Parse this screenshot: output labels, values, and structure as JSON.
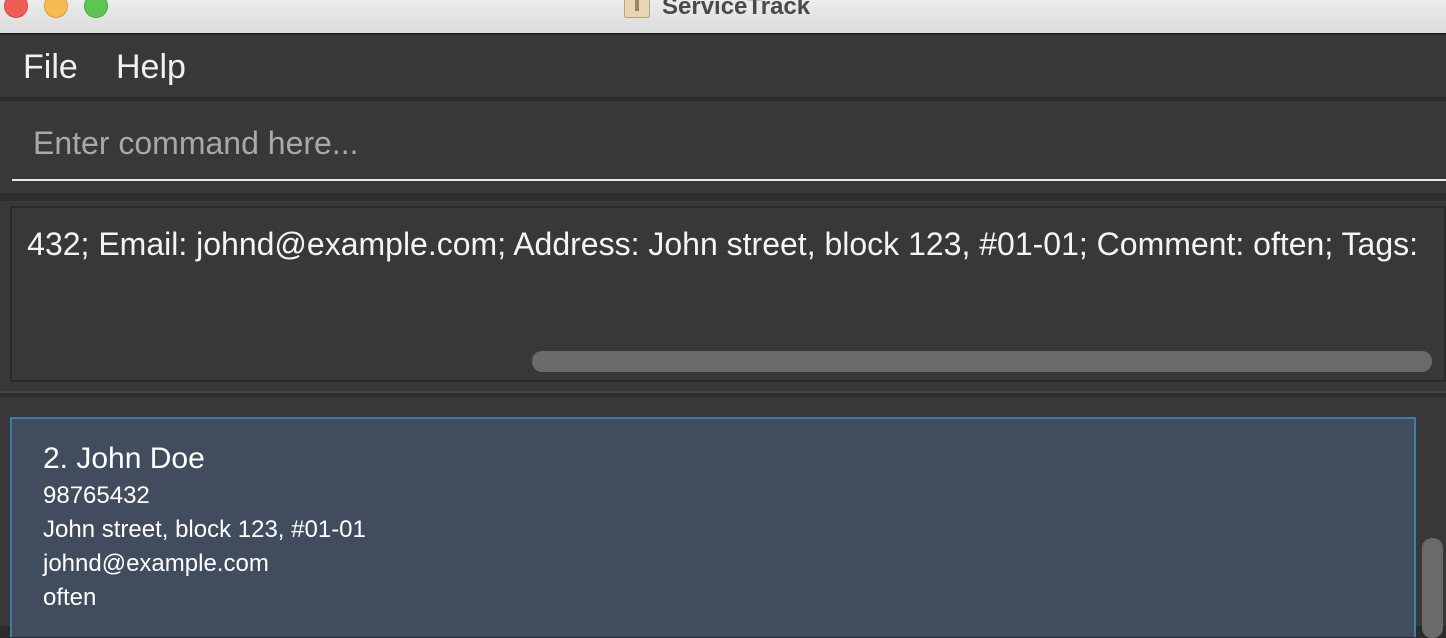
{
  "window": {
    "title": "ServiceTrack"
  },
  "menu": {
    "items": [
      {
        "label": "File"
      },
      {
        "label": "Help"
      }
    ]
  },
  "command": {
    "value": "",
    "placeholder": "Enter command here..."
  },
  "result": {
    "text": "432; Email: johnd@example.com; Address: John street, block 123, #01-01; Comment: often; Tags:"
  },
  "person_list": {
    "items": [
      {
        "index_name": "2. John Doe",
        "phone": "98765432",
        "address": "John street, block 123, #01-01",
        "email": "johnd@example.com",
        "comment": "often"
      }
    ]
  },
  "colors": {
    "background": "#383838",
    "card_background": "#414c5e",
    "card_border_selected": "#3d7ea8",
    "text": "#f0f0f0"
  }
}
